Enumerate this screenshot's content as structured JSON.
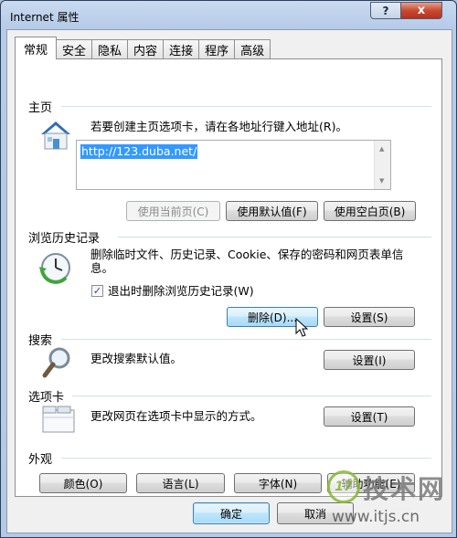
{
  "window": {
    "title": "Internet 属性",
    "help_label": "?",
    "close_label": "x"
  },
  "tabs": [
    "常规",
    "安全",
    "隐私",
    "内容",
    "连接",
    "程序",
    "高级"
  ],
  "home": {
    "title": "主页",
    "description": "若要创建主页选项卡，请在各地址行键入地址(R)。",
    "url": "http://123.duba.net/",
    "buttons": {
      "current": "使用当前页(C)",
      "default": "使用默认值(F)",
      "blank": "使用空白页(B)"
    }
  },
  "history": {
    "title": "浏览历史记录",
    "description": "删除临时文件、历史记录、Cookie、保存的密码和网页表单信息。",
    "checkbox_label": "退出时删除浏览历史记录(W)",
    "checkbox_checked": true,
    "delete_label": "删除(D)...",
    "settings_label": "设置(S)"
  },
  "search": {
    "title": "搜索",
    "description": "更改搜索默认值。",
    "settings_label": "设置(I)"
  },
  "tabs_section": {
    "title": "选项卡",
    "description": "更改网页在选项卡中显示的方式。",
    "settings_label": "设置(T)"
  },
  "appearance": {
    "title": "外观",
    "buttons": {
      "colors": "颜色(O)",
      "languages": "语言(L)",
      "fonts": "字体(N)",
      "accessibility": "辅助功能(E)"
    }
  },
  "footer": {
    "ok_label": "确定",
    "cancel_label": "取消"
  },
  "watermark": {
    "logo_num": "17",
    "brand": "技术网",
    "url": "www.itjs.cn"
  }
}
